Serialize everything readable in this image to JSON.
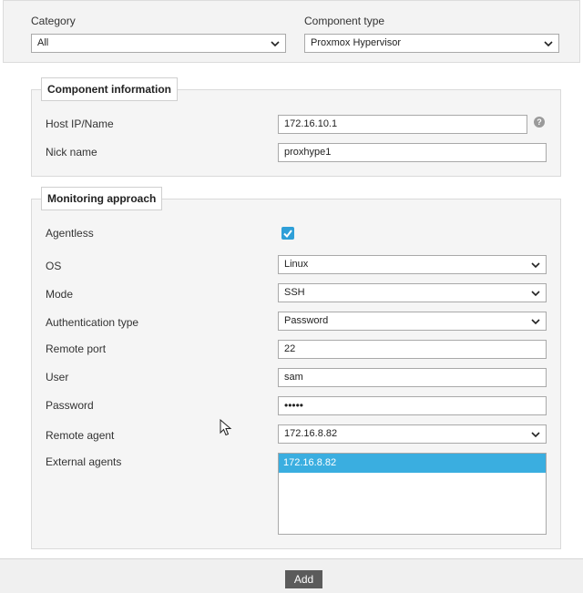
{
  "filters": {
    "category_label": "Category",
    "category_value": "All",
    "component_type_label": "Component type",
    "component_type_value": "Proxmox Hypervisor"
  },
  "component_info": {
    "legend": "Component information",
    "host_label": "Host IP/Name",
    "host_value": "172.16.10.1",
    "help_icon": "?",
    "nick_label": "Nick name",
    "nick_value": "proxhype1"
  },
  "monitoring": {
    "legend": "Monitoring approach",
    "agentless_label": "Agentless",
    "agentless_checked": true,
    "os_label": "OS",
    "os_value": "Linux",
    "mode_label": "Mode",
    "mode_value": "SSH",
    "auth_label": "Authentication type",
    "auth_value": "Password",
    "port_label": "Remote port",
    "port_value": "22",
    "user_label": "User",
    "user_value": "sam",
    "password_label": "Password",
    "password_value": "•••••",
    "remote_agent_label": "Remote agent",
    "remote_agent_value": "172.16.8.82",
    "external_agents_label": "External agents",
    "external_agents": [
      "172.16.8.82"
    ]
  },
  "footer": {
    "add_label": "Add"
  },
  "colors": {
    "accent": "#3aaee0",
    "button": "#5b5b5b"
  }
}
